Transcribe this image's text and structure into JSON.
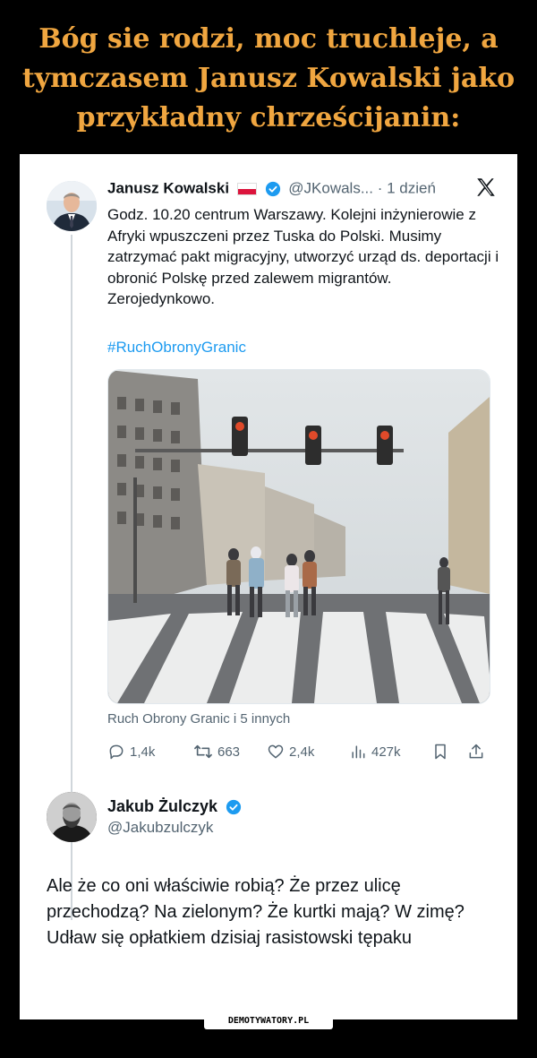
{
  "meme": {
    "title": "Bóg sie rodzi, moc truchleje, a tymczasem Janusz Kowalski jako przykładny chrześcijanin:",
    "watermark": "DEMOTYWATORY.PL"
  },
  "tweet1": {
    "name": "Janusz Kowalski",
    "handle": "@JKowals...",
    "time": "· 1 dzień",
    "text": "Godz. 10.20 centrum Warszawy. Kolejni inżynierowie z Afryki wpuszczeni przez Tuska do Polski. Musimy zatrzymać pakt migracyjny, utworzyć urząd ds. deportacji i obronić Polskę przed zalewem migrantów. Zerojedynkowo.",
    "hashtag": "#RuchObronyGranic",
    "from": "Ruch Obrony Granic i 5 innych",
    "stats": {
      "replies": "1,4k",
      "reposts": "663",
      "likes": "2,4k",
      "views": "427k"
    },
    "icons": [
      "flag-poland-icon",
      "verified-badge-icon",
      "x-logo-icon",
      "reply-icon",
      "repost-icon",
      "like-icon",
      "views-icon",
      "bookmark-icon",
      "share-icon"
    ]
  },
  "tweet2": {
    "name": "Jakub Żulczyk",
    "handle": "@Jakubzulczyk",
    "text": "Ale że co oni właściwie robią? Że przez ulicę przechodzą? Na zielonym? Że kurtki mają? W zimę? Udław się opłatkiem dzisiaj rasistowski tępaku"
  },
  "colors": {
    "title": "#f0a640",
    "link": "#1d9bf0",
    "verified": "#1d9bf0",
    "muted": "#536471",
    "background": "#000000",
    "card": "#ffffff"
  }
}
